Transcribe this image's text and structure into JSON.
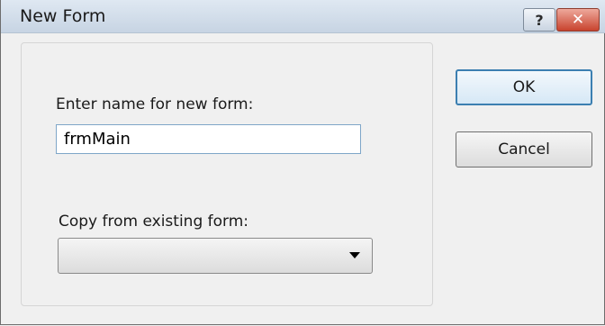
{
  "dialog": {
    "title": "New Form",
    "help_glyph": "?",
    "close_glyph": "✕"
  },
  "form": {
    "name_label": "Enter name for new form:",
    "name_value": "frmMain",
    "copy_label": "Copy from existing form:",
    "copy_selected": ""
  },
  "buttons": {
    "ok_label": "OK",
    "cancel_label": "Cancel"
  }
}
